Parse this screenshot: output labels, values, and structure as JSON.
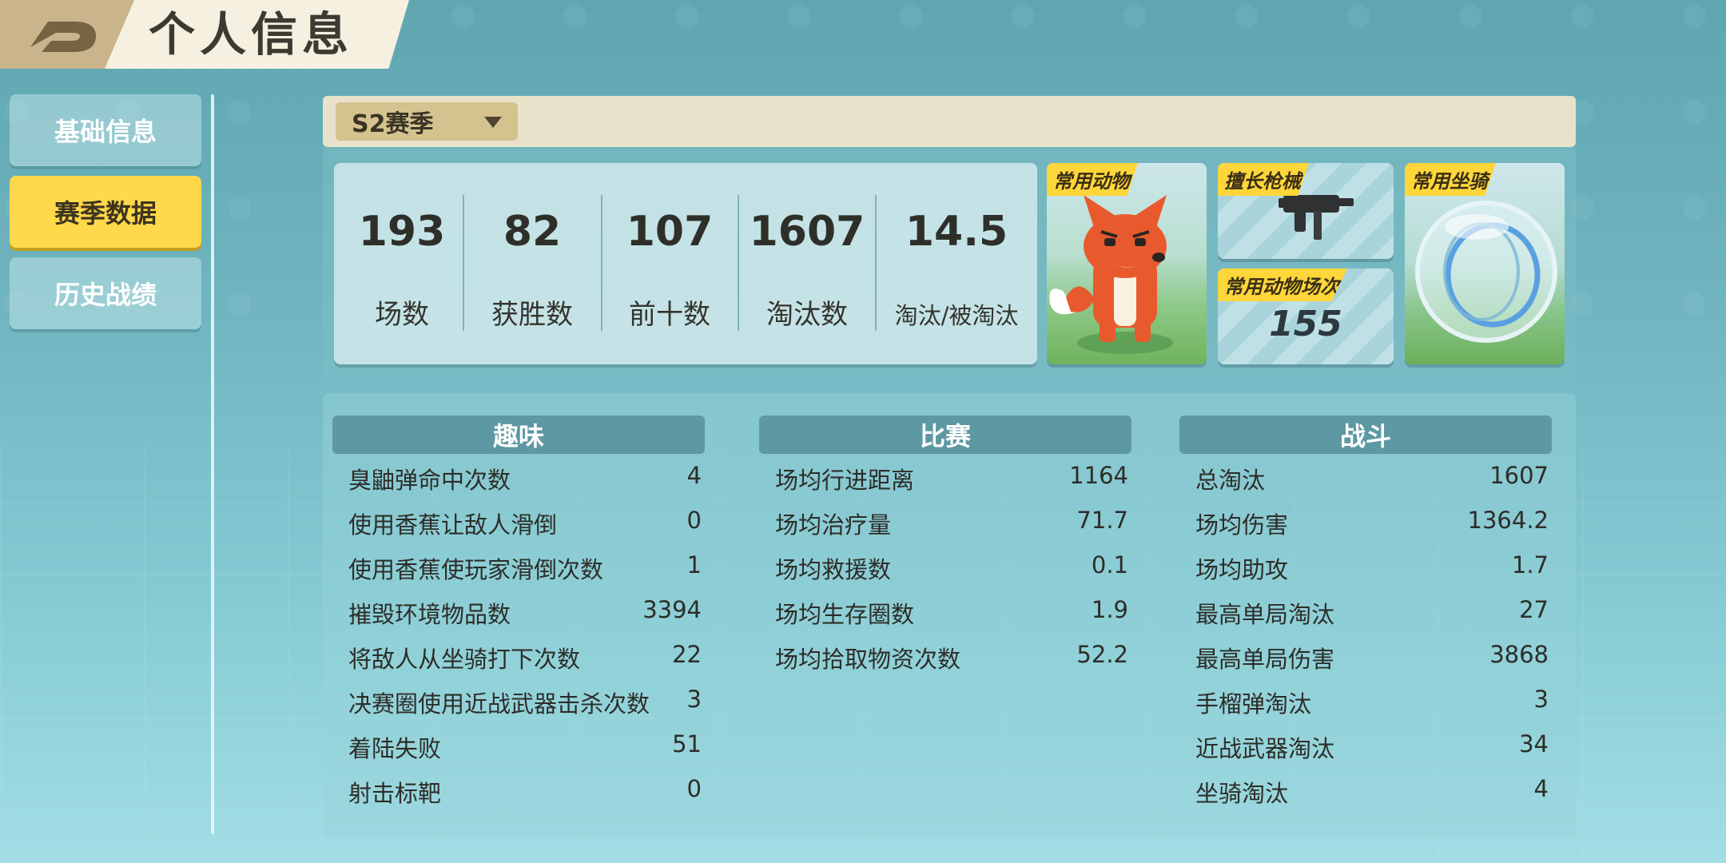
{
  "header": {
    "title": "个人信息"
  },
  "sidebar": {
    "items": [
      {
        "label": "基础信息"
      },
      {
        "label": "赛季数据"
      },
      {
        "label": "历史战绩"
      }
    ],
    "active_index": 1
  },
  "season": {
    "selected": "S2赛季"
  },
  "summary": {
    "stats": [
      {
        "value": "193",
        "label": "场数"
      },
      {
        "value": "82",
        "label": "获胜数"
      },
      {
        "value": "107",
        "label": "前十数"
      },
      {
        "value": "1607",
        "label": "淘汰数"
      },
      {
        "value": "14.5",
        "label": "淘汰/被淘汰"
      }
    ],
    "cards": {
      "animal_tag": "常用动物",
      "weapon_tag": "擅长枪械",
      "count_tag": "常用动物场次",
      "count_value": "155",
      "mount_tag": "常用坐骑"
    }
  },
  "categories": {
    "fun": {
      "title": "趣味",
      "rows": [
        {
          "k": "臭鼬弹命中次数",
          "v": "4"
        },
        {
          "k": "使用香蕉让敌人滑倒",
          "v": "0"
        },
        {
          "k": "使用香蕉使玩家滑倒次数",
          "v": "1"
        },
        {
          "k": "摧毁环境物品数",
          "v": "3394"
        },
        {
          "k": "将敌人从坐骑打下次数",
          "v": "22"
        },
        {
          "k": "决赛圈使用近战武器击杀次数",
          "v": "3"
        },
        {
          "k": "着陆失败",
          "v": "51"
        },
        {
          "k": "射击标靶",
          "v": "0"
        }
      ]
    },
    "match": {
      "title": "比赛",
      "rows": [
        {
          "k": "场均行进距离",
          "v": "1164"
        },
        {
          "k": "场均治疗量",
          "v": "71.7"
        },
        {
          "k": "场均救援数",
          "v": "0.1"
        },
        {
          "k": "场均生存圈数",
          "v": "1.9"
        },
        {
          "k": "场均拾取物资次数",
          "v": "52.2"
        }
      ]
    },
    "combat": {
      "title": "战斗",
      "rows": [
        {
          "k": "总淘汰",
          "v": "1607"
        },
        {
          "k": "场均伤害",
          "v": "1364.2"
        },
        {
          "k": "场均助攻",
          "v": "1.7"
        },
        {
          "k": "最高单局淘汰",
          "v": "27"
        },
        {
          "k": "最高单局伤害",
          "v": "3868"
        },
        {
          "k": "手榴弹淘汰",
          "v": "3"
        },
        {
          "k": "近战武器淘汰",
          "v": "34"
        },
        {
          "k": "坐骑淘汰",
          "v": "4"
        }
      ]
    }
  }
}
